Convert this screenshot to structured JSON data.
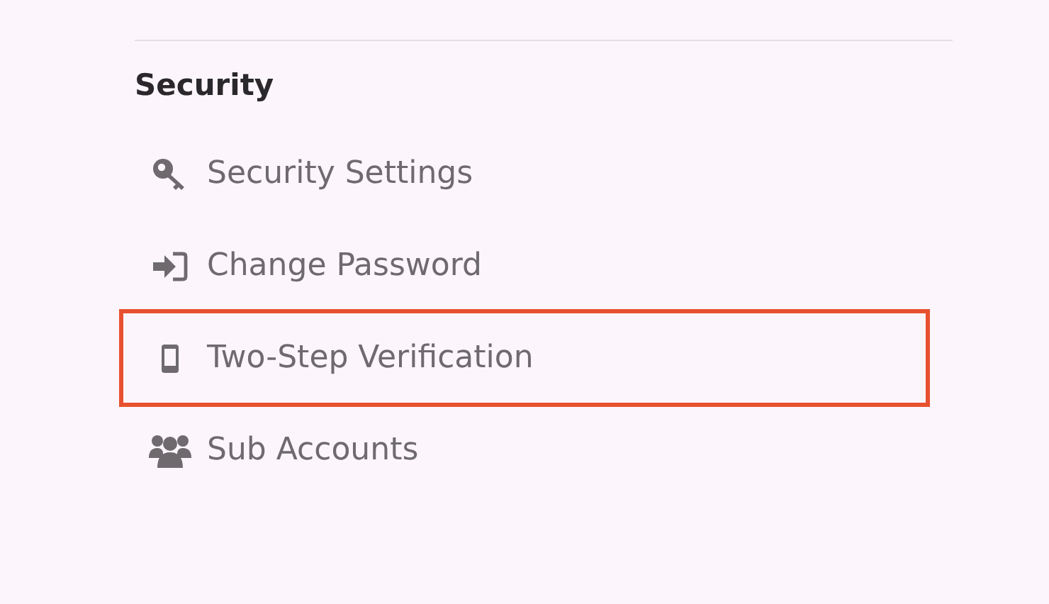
{
  "section": {
    "title": "Security"
  },
  "items": [
    {
      "kind": "key",
      "label": "Security Settings",
      "highlighted": false
    },
    {
      "kind": "signin",
      "label": "Change Password",
      "highlighted": false
    },
    {
      "kind": "phone",
      "label": "Two-Step Verification",
      "highlighted": true
    },
    {
      "kind": "users",
      "label": "Sub Accounts",
      "highlighted": false
    }
  ]
}
